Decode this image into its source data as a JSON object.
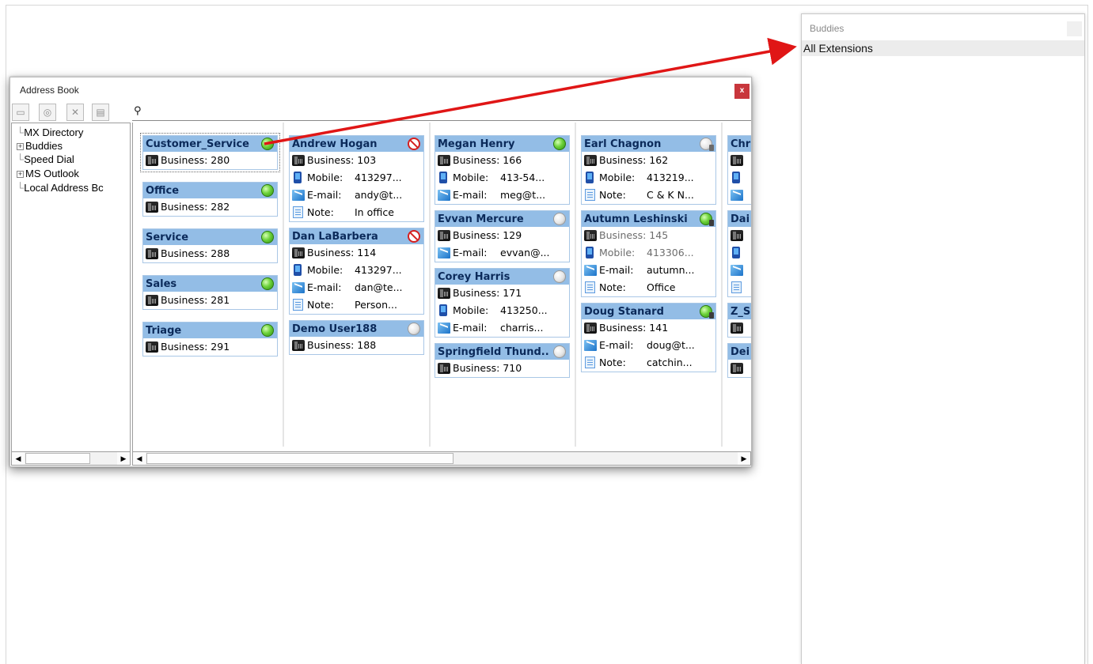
{
  "address_book": {
    "title": "Address Book",
    "close": "x",
    "toolbar": [
      {
        "name": "new-contact-icon",
        "glyph": "▭"
      },
      {
        "name": "status-icon",
        "glyph": "◎"
      },
      {
        "name": "delete-icon",
        "glyph": "✕"
      },
      {
        "name": "export-icon",
        "glyph": "▤"
      }
    ],
    "search": {
      "placeholder": ""
    },
    "tree": [
      {
        "label": "MX Directory",
        "expander": ""
      },
      {
        "label": "Buddies",
        "expander": "+"
      },
      {
        "label": "Speed Dial",
        "expander": ""
      },
      {
        "label": "MS Outlook",
        "expander": "+"
      },
      {
        "label": "Local Address Bc",
        "expander": ""
      }
    ],
    "columns": [
      [
        {
          "name": "Customer_Service",
          "status": "green",
          "selected": true,
          "rows": [
            {
              "type": "phone",
              "label": "Business: ",
              "value": "280"
            }
          ]
        },
        {
          "name": "Office",
          "status": "green",
          "rows": [
            {
              "type": "phone",
              "label": "Business: ",
              "value": "282"
            }
          ]
        },
        {
          "name": "Service",
          "status": "green",
          "rows": [
            {
              "type": "phone",
              "label": "Business: ",
              "value": "288"
            }
          ]
        },
        {
          "name": "Sales",
          "status": "green",
          "rows": [
            {
              "type": "phone",
              "label": "Business: ",
              "value": "281"
            }
          ]
        },
        {
          "name": "Triage",
          "status": "green",
          "rows": [
            {
              "type": "phone",
              "label": "Business: ",
              "value": "291"
            }
          ]
        }
      ],
      [
        {
          "name": "Andrew Hogan",
          "status": "dnd",
          "rows": [
            {
              "type": "phone",
              "label": "Business: ",
              "value": "103"
            },
            {
              "type": "mobile",
              "label": "Mobile:",
              "value": "413297..."
            },
            {
              "type": "email",
              "label": "E-mail:",
              "value": "andy@t..."
            },
            {
              "type": "note",
              "label": "Note:",
              "value": "In office"
            }
          ]
        },
        {
          "name": "Dan LaBarbera",
          "status": "dnd",
          "rows": [
            {
              "type": "phone",
              "label": "Business: ",
              "value": "114"
            },
            {
              "type": "mobile",
              "label": "Mobile:",
              "value": "413297..."
            },
            {
              "type": "email",
              "label": "E-mail:",
              "value": "dan@te..."
            },
            {
              "type": "note",
              "label": "Note:",
              "value": "Person..."
            }
          ]
        },
        {
          "name": "Demo User188",
          "status": "gray",
          "rows": [
            {
              "type": "phone",
              "label": "Business: ",
              "value": "188"
            }
          ]
        }
      ],
      [
        {
          "name": "Megan Henry",
          "status": "green",
          "rows": [
            {
              "type": "phone",
              "label": "Business: ",
              "value": "166"
            },
            {
              "type": "mobile",
              "label": "Mobile:",
              "value": "413-54..."
            },
            {
              "type": "email",
              "label": "E-mail:",
              "value": "meg@t..."
            }
          ]
        },
        {
          "name": "Evvan Mercure",
          "status": "gray",
          "rows": [
            {
              "type": "phone",
              "label": "Business: ",
              "value": "129"
            },
            {
              "type": "email",
              "label": "E-mail:",
              "value": "evvan@..."
            }
          ]
        },
        {
          "name": "Corey Harris",
          "status": "gray",
          "rows": [
            {
              "type": "phone",
              "label": "Business: ",
              "value": "171"
            },
            {
              "type": "mobile",
              "label": "Mobile:",
              "value": "413250..."
            },
            {
              "type": "email",
              "label": "E-mail:",
              "value": "charris..."
            }
          ]
        },
        {
          "name": "Springfield Thund..",
          "status": "gray",
          "rows": [
            {
              "type": "phone",
              "label": "Business: ",
              "value": "710"
            }
          ]
        }
      ],
      [
        {
          "name": "Earl Chagnon",
          "status": "phone",
          "rows": [
            {
              "type": "phone",
              "label": "Business: ",
              "value": "162"
            },
            {
              "type": "mobile",
              "label": "Mobile:",
              "value": "413219..."
            },
            {
              "type": "note",
              "label": "Note:",
              "value": "C & K N..."
            }
          ]
        },
        {
          "name": "Autumn Leshinski",
          "status": "greenphone",
          "dim": true,
          "rows": [
            {
              "type": "phone",
              "label": "Business: ",
              "value": "145"
            },
            {
              "type": "mobile",
              "label": "Mobile:",
              "value": "413306..."
            },
            {
              "type": "email",
              "label": "E-mail:",
              "value": "autumn..."
            },
            {
              "type": "note",
              "label": "Note:",
              "value": "Office"
            }
          ]
        },
        {
          "name": "Doug Stanard",
          "status": "greenphone",
          "rows": [
            {
              "type": "phone",
              "label": "Business: ",
              "value": "141"
            },
            {
              "type": "email",
              "label": "E-mail:",
              "value": "doug@t..."
            },
            {
              "type": "note",
              "label": "Note:",
              "value": "catchin..."
            }
          ]
        }
      ],
      [
        {
          "name": "Chr",
          "status": "none",
          "rows": [
            {
              "type": "phone",
              "label": "",
              "value": ""
            },
            {
              "type": "mobile",
              "label": "",
              "value": ""
            },
            {
              "type": "email",
              "label": "",
              "value": ""
            }
          ]
        },
        {
          "name": "Dai",
          "status": "none",
          "rows": [
            {
              "type": "phone",
              "label": "",
              "value": ""
            },
            {
              "type": "mobile",
              "label": "",
              "value": ""
            },
            {
              "type": "email",
              "label": "",
              "value": ""
            },
            {
              "type": "note",
              "label": "",
              "value": ""
            }
          ]
        },
        {
          "name": "Z_S",
          "status": "none",
          "rows": [
            {
              "type": "phone",
              "label": "",
              "value": ""
            }
          ]
        },
        {
          "name": "Dei",
          "status": "none",
          "rows": [
            {
              "type": "phone",
              "label": "",
              "value": ""
            }
          ]
        }
      ]
    ]
  },
  "buddies": {
    "title": "Buddies",
    "items": [
      "All Extensions"
    ]
  },
  "colors": {
    "card_header": "#93bde6",
    "card_border": "#a9c7e6",
    "close_red": "#c8363c",
    "arrow_red": "#e01616"
  }
}
